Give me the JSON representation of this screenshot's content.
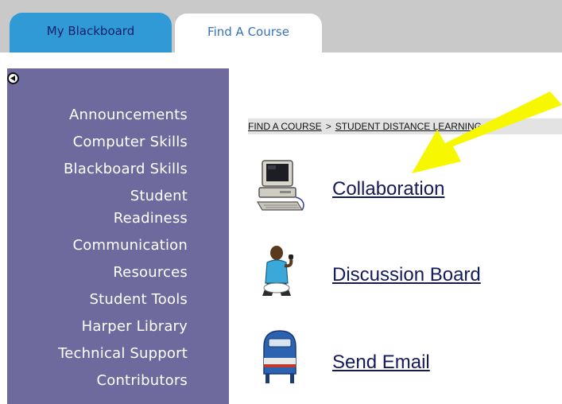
{
  "tabs": [
    {
      "label": "My Blackboard",
      "active": false
    },
    {
      "label": "Find A Course",
      "active": true
    }
  ],
  "left_menu": {
    "collapse_icon": "left-arrow-circle-icon",
    "items": [
      {
        "label": "Announcements"
      },
      {
        "label": "Computer Skills"
      },
      {
        "label": "Blackboard Skills"
      },
      {
        "label": "Student Readiness",
        "lines": [
          "Student",
          "Readiness"
        ]
      },
      {
        "label": "Communication"
      },
      {
        "label": "Resources"
      },
      {
        "label": "Student Tools"
      },
      {
        "label": "Harper Library"
      },
      {
        "label": "Technical Support"
      },
      {
        "label": "Contributors"
      }
    ]
  },
  "breadcrumb": {
    "items": [
      "FIND A COURSE",
      "STUDENT DISTANCE LEARNING"
    ],
    "separator": ">"
  },
  "tools": [
    {
      "label": "Collaboration",
      "icon": "computer-icon"
    },
    {
      "label": "Discussion Board",
      "icon": "person-speaking-icon"
    },
    {
      "label": "Send Email",
      "icon": "mailbox-icon"
    }
  ],
  "colors": {
    "tab_strip": "#c9c9c9",
    "tab_blue": "#2f9ad6",
    "menu_bg": "#6e6a9e",
    "link": "#151a5a",
    "arrow": "#f7f700"
  }
}
